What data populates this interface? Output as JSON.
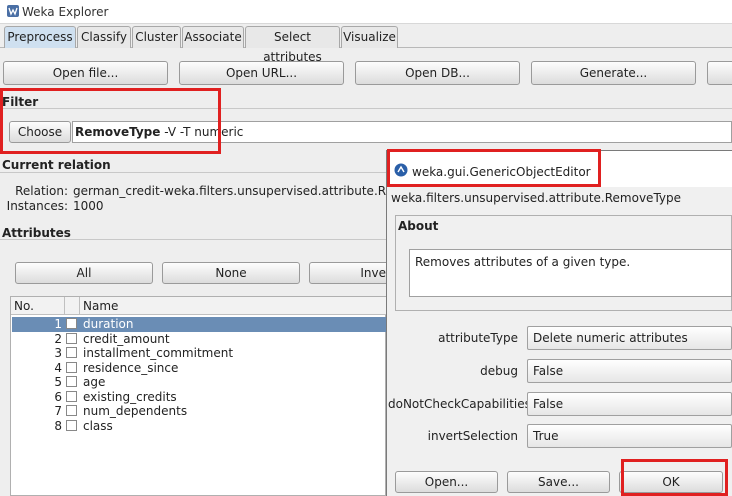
{
  "window": {
    "title": "Weka Explorer"
  },
  "tabs": [
    "Preprocess",
    "Classify",
    "Cluster",
    "Associate",
    "Select attributes",
    "Visualize"
  ],
  "toolbar": {
    "open_file": "Open file...",
    "open_url": "Open URL...",
    "open_db": "Open DB...",
    "generate": "Generate..."
  },
  "filter": {
    "heading": "Filter",
    "choose": "Choose",
    "name": "RemoveType",
    "args": " -V -T numeric"
  },
  "relation": {
    "heading": "Current relation",
    "relation_label": "Relation:",
    "relation_value": "german_credit-weka.filters.unsupervised.attribute.RemoveType",
    "instances_label": "Instances:",
    "instances_value": "1000"
  },
  "attributes": {
    "heading": "Attributes",
    "btn_all": "All",
    "btn_none": "None",
    "btn_invert": "Invert",
    "col_no": "No.",
    "col_name": "Name",
    "rows": [
      {
        "no": "1",
        "name": "duration"
      },
      {
        "no": "2",
        "name": "credit_amount"
      },
      {
        "no": "3",
        "name": "installment_commitment"
      },
      {
        "no": "4",
        "name": "residence_since"
      },
      {
        "no": "5",
        "name": "age"
      },
      {
        "no": "6",
        "name": "existing_credits"
      },
      {
        "no": "7",
        "name": "num_dependents"
      },
      {
        "no": "8",
        "name": "class"
      }
    ]
  },
  "dialog": {
    "title": "weka.gui.GenericObjectEditor",
    "classname": "weka.filters.unsupervised.attribute.RemoveType",
    "about_heading": "About",
    "about_text": "Removes attributes of a given type.",
    "props": [
      {
        "label": "attributeType",
        "value": "Delete numeric attributes"
      },
      {
        "label": "debug",
        "value": "False"
      },
      {
        "label": "doNotCheckCapabilities",
        "value": "False"
      },
      {
        "label": "invertSelection",
        "value": "True"
      }
    ],
    "open": "Open...",
    "save": "Save...",
    "ok": "OK"
  },
  "colors": {
    "highlight": "#e02020",
    "selected_row": "#6a8db5",
    "active_tab": "#cfe0f0"
  }
}
